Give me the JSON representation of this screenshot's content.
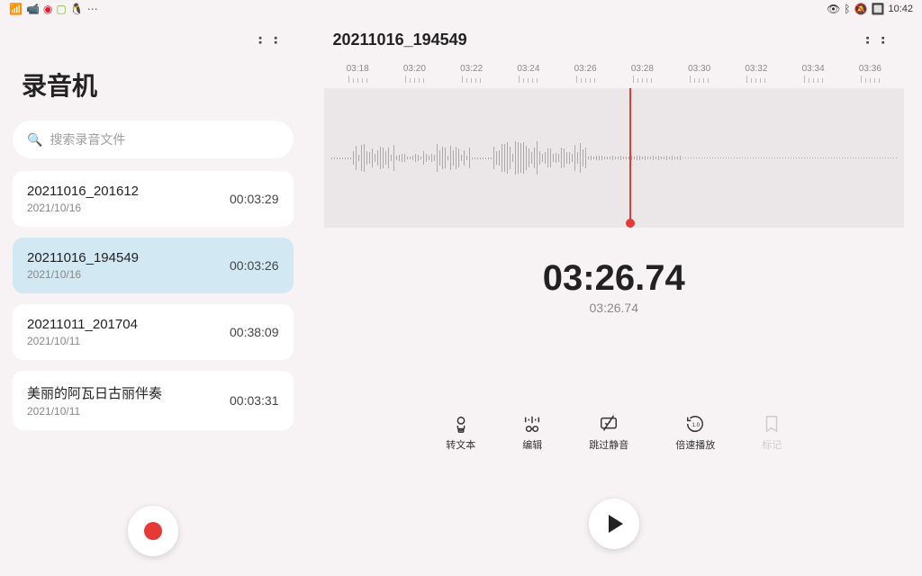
{
  "status": {
    "time": "10:42",
    "icons_left": [
      "wifi",
      "video",
      "weibo",
      "wechat",
      "penguin"
    ],
    "icons_right": [
      "eye",
      "bluetooth",
      "mute",
      "battery"
    ]
  },
  "left": {
    "title": "录音机",
    "search_placeholder": "搜索录音文件",
    "recordings": [
      {
        "name": "20211016_201612",
        "date": "2021/10/16",
        "duration": "00:03:29",
        "selected": false
      },
      {
        "name": "20211016_194549",
        "date": "2021/10/16",
        "duration": "00:03:26",
        "selected": true
      },
      {
        "name": "20211011_201704",
        "date": "2021/10/11",
        "duration": "00:38:09",
        "selected": false
      },
      {
        "name": "美丽的阿瓦日古丽伴奏",
        "date": "2021/10/11",
        "duration": "00:03:31",
        "selected": false
      }
    ]
  },
  "right": {
    "file_title": "20211016_194549",
    "timeline_labels": [
      "03:18",
      "03:20",
      "03:22",
      "03:24",
      "03:26",
      "03:28",
      "03:30",
      "03:32",
      "03:34",
      "03:36"
    ],
    "current_time": "03:26.74",
    "total_time": "03:26.74",
    "tools": [
      {
        "label": "转文本",
        "icon": "transcribe"
      },
      {
        "label": "编辑",
        "icon": "edit"
      },
      {
        "label": "跳过静音",
        "icon": "skip-silence"
      },
      {
        "label": "倍速播放",
        "icon": "speed"
      },
      {
        "label": "标记",
        "icon": "bookmark",
        "disabled": true
      }
    ]
  }
}
